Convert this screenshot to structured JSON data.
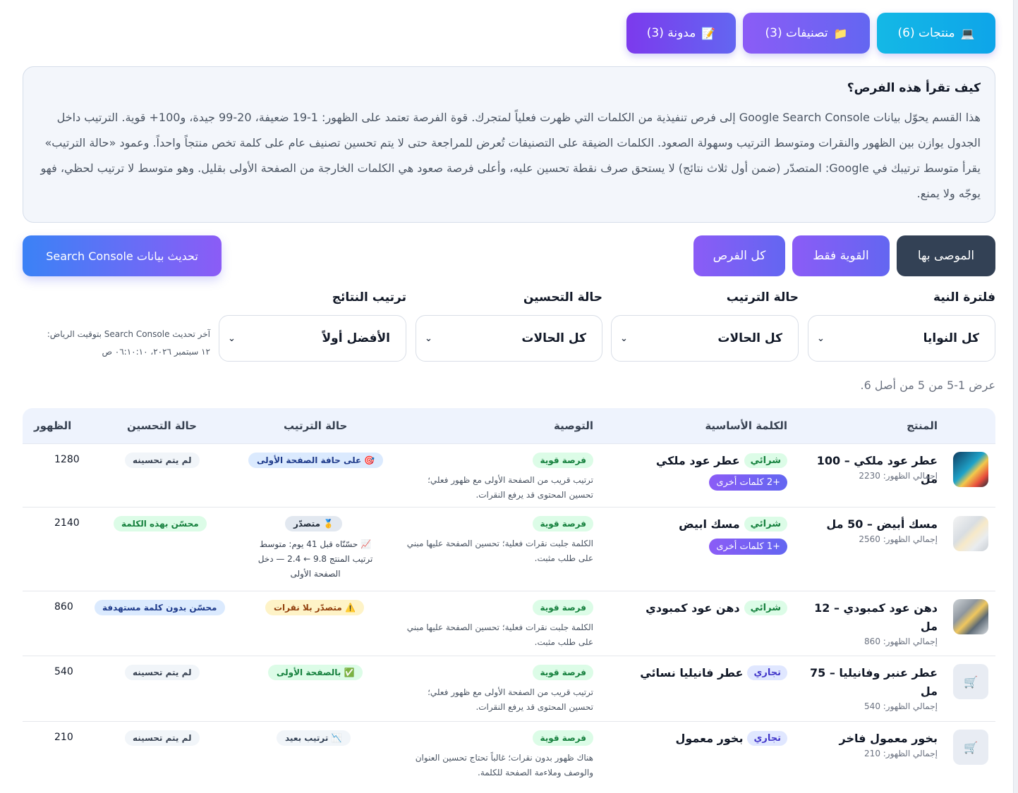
{
  "tabs": [
    {
      "label": "منتجات (6)",
      "icon": "laptop-icon",
      "glyph": "💻"
    },
    {
      "label": "تصنيفات (3)",
      "icon": "folder-icon",
      "glyph": "📁"
    },
    {
      "label": "مدونة (3)",
      "icon": "memo-icon",
      "glyph": "📝"
    }
  ],
  "info": {
    "title": "كيف تقرأ هذه الفرص؟",
    "body": "هذا القسم يحوّل بيانات Google Search Console إلى فرص تنفيذية من الكلمات التي ظهرت فعلياً لمتجرك. قوة الفرصة تعتمد على الظهور: 1-19 ضعيفة، 20-99 جيدة، و100+ قوية. الترتيب داخل الجدول يوازن بين الظهور والنقرات ومتوسط الترتيب وسهولة الصعود. الكلمات الضيقة على التصنيفات تُعرض للمراجعة حتى لا يتم تحسين تصنيف عام على كلمة تخص منتجاً واحداً. وعمود «حالة الترتيب» يقرأ متوسط ترتيبك في Google: المتصدّر (ضمن أول ثلاث نتائج) لا يستحق صرف نقطة تحسين عليه، وأعلى فرصة صعود هي الكلمات الخارجة من الصفحة الأولى بقليل. وهو متوسط لا ترتيب لحظي، فهو يوجّه ولا يمنع."
  },
  "filters": {
    "recommended": "الموصى بها",
    "strong_only": "القوية فقط",
    "all": "كل الفرص",
    "refresh": "تحديث بيانات Search Console"
  },
  "selects": {
    "intent": {
      "label": "فلترة النية",
      "value": "كل النوايا"
    },
    "rank": {
      "label": "حالة الترتيب",
      "value": "كل الحالات"
    },
    "improve": {
      "label": "حالة التحسين",
      "value": "كل الحالات"
    },
    "sort": {
      "label": "ترتيب النتائج",
      "value": "الأفضل أولاً"
    }
  },
  "last_update": {
    "line1": "آخر تحديث Search Console بتوقيت الرياض:",
    "line2": "١٢ سبتمبر ٢٠٢٦، ٠٦:١٠:١٠ ص"
  },
  "count_text": "عرض 1-5 من 5 من أصل 6.",
  "table": {
    "headers": {
      "product": "المنتج",
      "keyword": "الكلمة الأساسية",
      "recommendation": "التوصية",
      "rank_status": "حالة الترتيب",
      "improve_status": "حالة التحسين",
      "impressions": "الظهور"
    },
    "rows": [
      {
        "name": "عطر عود ملكي – 100 مل",
        "sub": "إجمالي الظهور: 2230",
        "thumb": "photo",
        "intent": "شرائي",
        "keyword": "عطر عود ملكي",
        "more": "+2 كلمات أخرى",
        "badge": "فرصة قوية",
        "rec": "ترتيب قريب من الصفحة الأولى مع ظهور فعلي؛ تحسين المحتوى قد يرفع النقرات.",
        "rank_label": "على حافة الصفحة الأولى",
        "rank_glyph": "🎯",
        "rank_note": "",
        "improve": "لم يتم تحسينه",
        "views": "1280"
      },
      {
        "name": "مسك أبيض – 50 مل",
        "sub": "إجمالي الظهور: 2560",
        "thumb": "photo",
        "intent": "شرائي",
        "keyword": "مسك ابيض",
        "more": "+1 كلمات أخرى",
        "badge": "فرصة قوية",
        "rec": "الكلمة جلبت نقرات فعلية؛ تحسين الصفحة عليها مبني على طلب مثبت.",
        "rank_label": "متصدّر",
        "rank_glyph": "🥇",
        "rank_note": "📈 حسّنّاه قبل 41 يوم: متوسط ترتيب المنتج 9.8 ← 2.4 — دخل الصفحة الأولى",
        "improve": "محسّن بهذه الكلمة",
        "views": "2140"
      },
      {
        "name": "دهن عود كمبودي – 12 مل",
        "sub": "إجمالي الظهور: 860",
        "thumb": "photo",
        "intent": "شرائي",
        "keyword": "دهن عود كمبودي",
        "more": "",
        "badge": "فرصة قوية",
        "rec": "الكلمة جلبت نقرات فعلية؛ تحسين الصفحة عليها مبني على طلب مثبت.",
        "rank_label": "متصدّر بلا نقرات",
        "rank_glyph": "⚠️",
        "rank_note": "",
        "improve": "محسّن بدون كلمة مستهدفة",
        "views": "860"
      },
      {
        "name": "عطر عنبر وفانيليا – 75 مل",
        "sub": "إجمالي الظهور: 540",
        "thumb": "cart",
        "intent": "تجاري",
        "keyword": "عطر فانيليا نسائي",
        "more": "",
        "badge": "فرصة قوية",
        "rec": "ترتيب قريب من الصفحة الأولى مع ظهور فعلي؛ تحسين المحتوى قد يرفع النقرات.",
        "rank_label": "بالصفحة الأولى",
        "rank_glyph": "✅",
        "rank_note": "",
        "improve": "لم يتم تحسينه",
        "views": "540"
      },
      {
        "name": "بخور معمول فاخر",
        "sub": "إجمالي الظهور: 210",
        "thumb": "cart",
        "intent": "تجاري",
        "keyword": "بخور معمول",
        "more": "",
        "badge": "فرصة قوية",
        "rec": "هناك ظهور بدون نقرات؛ غالباً تحتاج تحسين العنوان والوصف وملاءمة الصفحة للكلمة.",
        "rank_label": "ترتيب بعيد",
        "rank_glyph": "📉",
        "rank_note": "",
        "improve": "لم يتم تحسينه",
        "views": "210"
      }
    ]
  }
}
